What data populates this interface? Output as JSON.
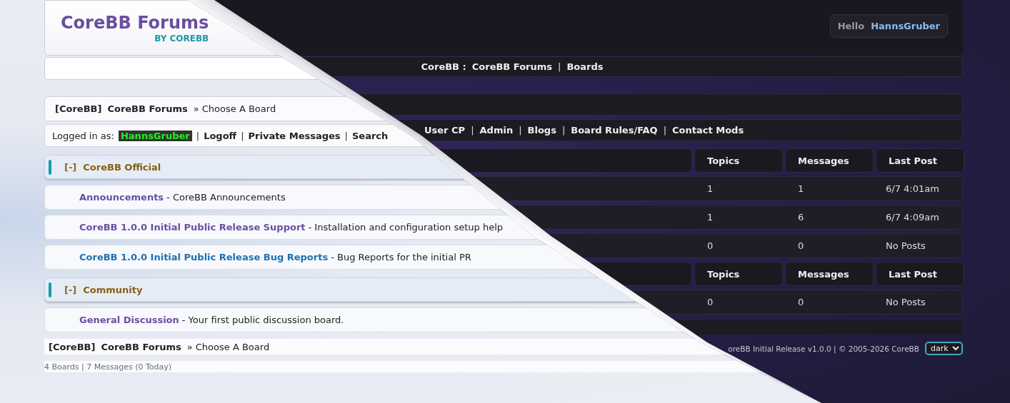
{
  "light_page": {
    "logo": {
      "title": "CoreBB Forums",
      "subtitle": "BY COREBB"
    },
    "breadcrumb": {
      "site": "[CoreBB]",
      "forum": "CoreBB Forums",
      "current": "» Choose A Board"
    },
    "user_bar": {
      "label": "Logged in as:",
      "username": "HannsGruber",
      "separator": "|",
      "links": [
        "Logoff",
        "Private Messages",
        "Search"
      ]
    },
    "categories": [
      {
        "toggle": "[-]",
        "name": "CoreBB Official",
        "boards": [
          {
            "name": "Announcements",
            "description": "- CoreBB Announcements",
            "color": "#6a4fa0"
          },
          {
            "name": "CoreBB 1.0.0 Initial Public Release Support",
            "description": "- Installation and configuration setup help",
            "color": "#6a4fa0"
          },
          {
            "name": "CoreBB 1.0.0 Initial Public Release Bug Reports",
            "description": "- Bug Reports for the initial PR",
            "color": "#1f6fae"
          }
        ]
      },
      {
        "toggle": "[-]",
        "name": "Community",
        "boards": [
          {
            "name": "General Discussion",
            "description": "- Your first public discussion board.",
            "color": "#6a4fa0"
          }
        ]
      }
    ],
    "footer_breadcrumb": {
      "site": "[CoreBB]",
      "forum": "CoreBB Forums",
      "current": "» Choose A Board"
    },
    "stats": "4 Boards | 7 Messages (0 Today)"
  },
  "dark_page": {
    "greeting": {
      "label": "Hello",
      "username": "HannsGruber"
    },
    "navbar": {
      "site": "CoreBB :",
      "separator": "|",
      "links": [
        "CoreBB Forums",
        "Boards"
      ]
    },
    "user_links": {
      "separator": "|",
      "links": [
        "User CP",
        "Admin",
        "Blogs",
        "Board Rules/FAQ",
        "Contact Mods"
      ]
    },
    "categories": [
      {
        "columns": [
          "Topics",
          "Messages",
          "Last Post"
        ],
        "boards": [
          {
            "topics": "1",
            "messages": "1",
            "last_post": "6/7 4:01am"
          },
          {
            "topics": "1",
            "messages": "6",
            "last_post": "6/7 4:09am"
          },
          {
            "topics": "0",
            "messages": "0",
            "last_post": "No Posts"
          }
        ]
      },
      {
        "columns": [
          "Topics",
          "Messages",
          "Last Post"
        ],
        "boards": [
          {
            "topics": "0",
            "messages": "0",
            "last_post": "No Posts"
          }
        ]
      }
    ],
    "footer": {
      "release": "oreBB Initial Release v1.0.0 | © 2005-2026 CoreBB",
      "theme_select": "dark"
    }
  }
}
